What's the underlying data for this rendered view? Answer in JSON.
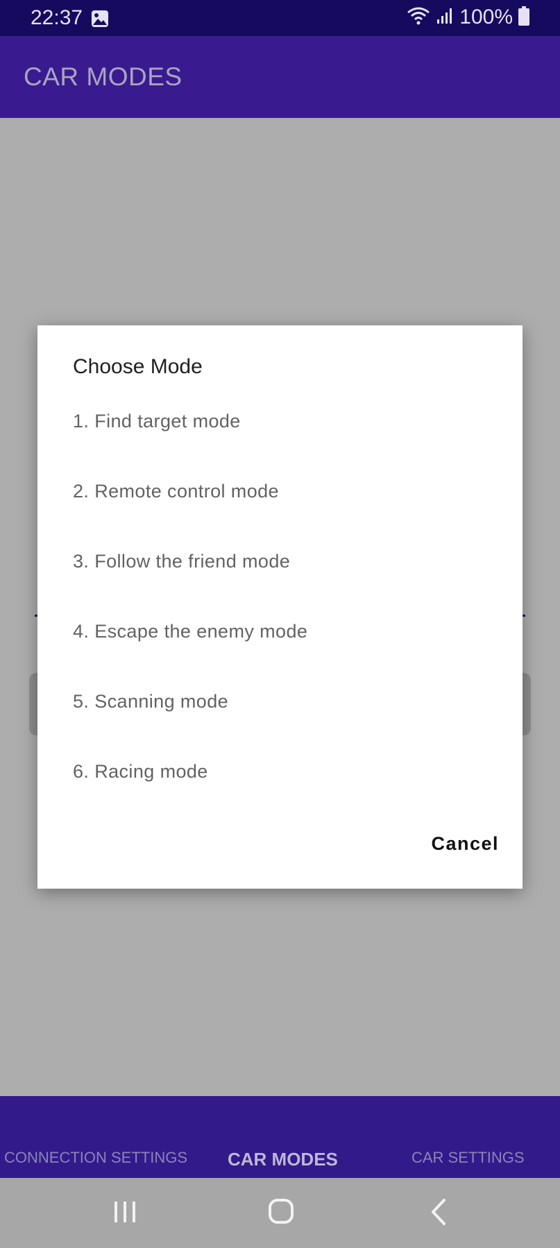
{
  "status_bar": {
    "time": "22:37",
    "battery_percent": "100%",
    "icons": [
      "gallery-icon",
      "wifi-icon",
      "signal-icon",
      "battery-icon"
    ]
  },
  "app_bar": {
    "title": "CAR MODES"
  },
  "dialog": {
    "title": "Choose Mode",
    "options": [
      "1. Find target mode",
      "2. Remote control mode",
      "3. Follow the friend mode",
      "4. Escape the enemy mode",
      "5. Scanning mode",
      "6. Racing mode"
    ],
    "cancel_label": "Cancel"
  },
  "bottom_tabs": {
    "connection": "CONNECTION SETTINGS",
    "modes": "CAR MODES",
    "settings": "CAR SETTINGS",
    "selected": "CAR MODES"
  },
  "nav_bar": {
    "icons": [
      "recent-apps-icon",
      "home-icon",
      "back-icon"
    ]
  },
  "colors": {
    "status_bar": "#160a5e",
    "app_bar": "#391b8f",
    "tab_bar": "#321a8b",
    "scrim": "#adadad"
  }
}
